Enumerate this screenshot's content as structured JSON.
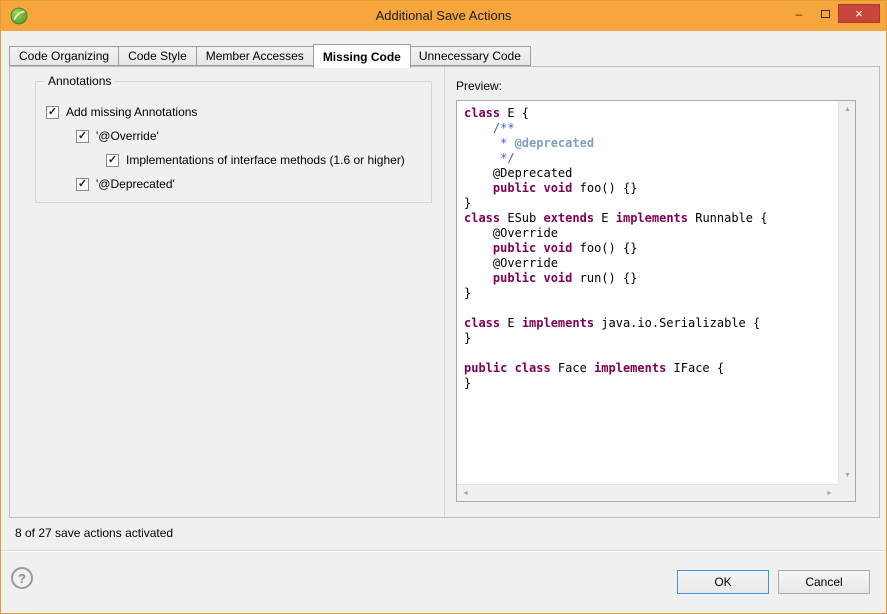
{
  "window": {
    "title": "Additional Save Actions"
  },
  "titlebar_icons": {
    "minimize": "–",
    "close": "×"
  },
  "tabs": [
    {
      "label": "Code Organizing",
      "active": false
    },
    {
      "label": "Code Style",
      "active": false
    },
    {
      "label": "Member Accesses",
      "active": false
    },
    {
      "label": "Missing Code",
      "active": true
    },
    {
      "label": "Unnecessary Code",
      "active": false
    }
  ],
  "annotations_group": {
    "title": "Annotations",
    "checkboxes": [
      {
        "label": "Add missing Annotations",
        "checked": true,
        "indent": 0
      },
      {
        "label": "'@Override'",
        "checked": true,
        "indent": 1
      },
      {
        "label": "Implementations of interface methods (1.6 or higher)",
        "checked": true,
        "indent": 2
      },
      {
        "label": "'@Deprecated'",
        "checked": true,
        "indent": 1
      }
    ]
  },
  "preview": {
    "label": "Preview:",
    "code_lines": [
      [
        [
          "k",
          "class"
        ],
        [
          "p",
          " E {"
        ]
      ],
      [
        [
          "c",
          "    /**"
        ]
      ],
      [
        [
          "c",
          "     * "
        ],
        [
          "t",
          "@deprecated"
        ]
      ],
      [
        [
          "c",
          "     */"
        ]
      ],
      [
        [
          "p",
          "    @Deprecated"
        ]
      ],
      [
        [
          "p",
          "    "
        ],
        [
          "k",
          "public void"
        ],
        [
          "p",
          " foo() {}"
        ]
      ],
      [
        [
          "p",
          "}"
        ]
      ],
      [
        [
          "k",
          "class"
        ],
        [
          "p",
          " ESub "
        ],
        [
          "k",
          "extends"
        ],
        [
          "p",
          " E "
        ],
        [
          "k",
          "implements"
        ],
        [
          "p",
          " Runnable {"
        ]
      ],
      [
        [
          "p",
          "    @Override"
        ]
      ],
      [
        [
          "p",
          "    "
        ],
        [
          "k",
          "public void"
        ],
        [
          "p",
          " foo() {}"
        ]
      ],
      [
        [
          "p",
          "    @Override"
        ]
      ],
      [
        [
          "p",
          "    "
        ],
        [
          "k",
          "public void"
        ],
        [
          "p",
          " run() {}"
        ]
      ],
      [
        [
          "p",
          "}"
        ]
      ],
      [],
      [
        [
          "k",
          "class"
        ],
        [
          "p",
          " E "
        ],
        [
          "k",
          "implements"
        ],
        [
          "p",
          " java.io.Serializable {"
        ]
      ],
      [
        [
          "p",
          "}"
        ]
      ],
      [],
      [
        [
          "k",
          "public class"
        ],
        [
          "p",
          " Face "
        ],
        [
          "k",
          "implements"
        ],
        [
          "p",
          " IFace {"
        ]
      ],
      [
        [
          "p",
          "}"
        ]
      ]
    ]
  },
  "status_text": "8 of 27 save actions activated",
  "footer": {
    "help_label": "?",
    "ok_label": "OK",
    "cancel_label": "Cancel"
  },
  "icons": {
    "check": "✓",
    "scroll_up": "▲",
    "scroll_down": "▼",
    "scroll_left": "◄",
    "scroll_right": "►"
  },
  "colors": {
    "titlebar": "#f6a63c",
    "window_border": "#e09a38",
    "close_button": "#c8463c",
    "keyword": "#7f0055",
    "comment": "#3f5fbf",
    "javadoc_tag": "#7f9fbf",
    "ok_focus_border": "#3e95e2"
  }
}
